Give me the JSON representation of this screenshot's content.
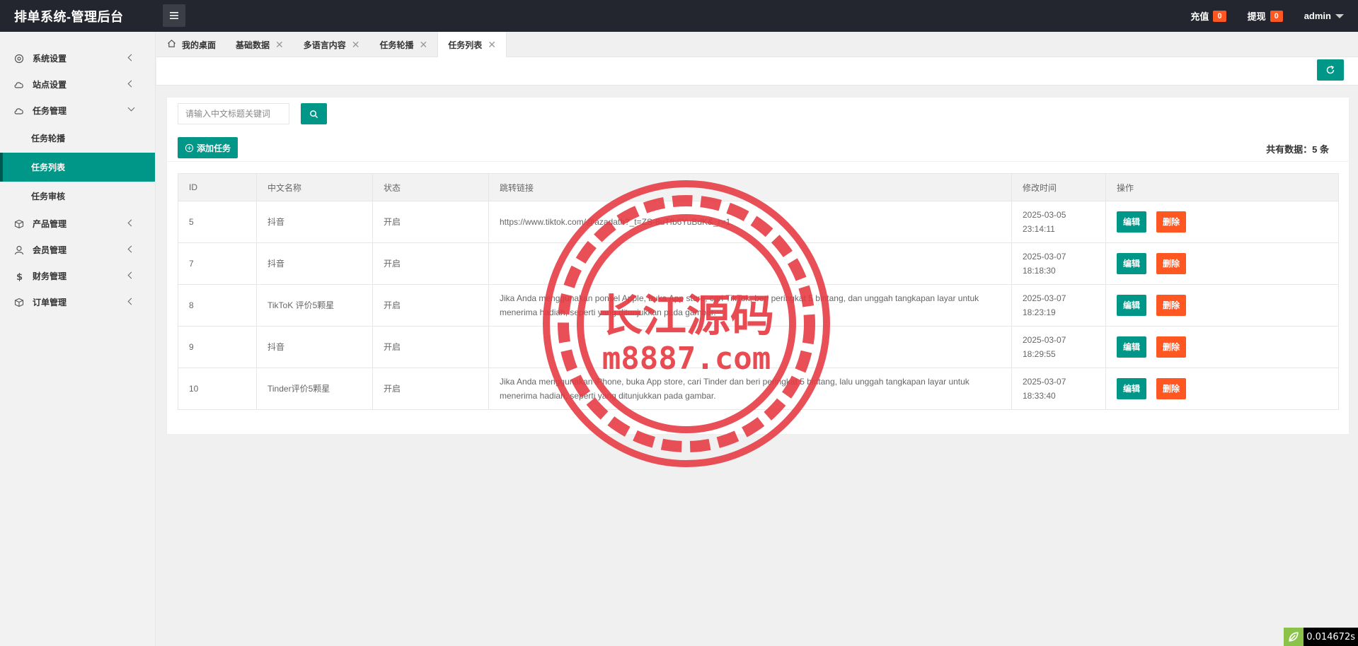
{
  "header": {
    "brand": "排单系统-管理后台",
    "recharge_label": "充值",
    "recharge_count": "0",
    "withdraw_label": "提现",
    "withdraw_count": "0",
    "user": "admin"
  },
  "sidebar": {
    "items": [
      {
        "label": "系统设置",
        "icon": "gear-icon"
      },
      {
        "label": "站点设置",
        "icon": "cloud-icon"
      },
      {
        "label": "任务管理",
        "icon": "cloud-icon"
      },
      {
        "label": "产品管理",
        "icon": "box-icon"
      },
      {
        "label": "会员管理",
        "icon": "user-icon"
      },
      {
        "label": "财务管理",
        "icon": "dollar-icon"
      },
      {
        "label": "订单管理",
        "icon": "box-icon"
      }
    ],
    "sub_items": [
      {
        "label": "任务轮播"
      },
      {
        "label": "任务列表"
      },
      {
        "label": "任务审核"
      }
    ]
  },
  "tabs": [
    {
      "label": "我的桌面"
    },
    {
      "label": "基础数据"
    },
    {
      "label": "多语言内容"
    },
    {
      "label": "任务轮播"
    },
    {
      "label": "任务列表"
    }
  ],
  "search": {
    "placeholder": "请输入中文标题关键词",
    "value": ""
  },
  "actions": {
    "add_label": "添加任务",
    "total_label": "共有数据：5 条"
  },
  "table": {
    "headers": [
      "ID",
      "中文名称",
      "状态",
      "跳转链接",
      "修改时间",
      "操作"
    ],
    "rows": [
      {
        "id": "5",
        "name": "抖音",
        "status": "开启",
        "link": "https://www.tiktok.com/@azadath?_t=ZS-8uTfb6YuBdK&_r=1",
        "time": "2025-03-05 23:14:11"
      },
      {
        "id": "7",
        "name": "抖音",
        "status": "开启",
        "link": "",
        "time": "2025-03-07 18:18:30"
      },
      {
        "id": "8",
        "name": "TikToK 评价5颗星",
        "status": "开启",
        "link": "Jika Anda menggunakan ponsel Apple, buka App store, cari TikTok, beri peringkat 5 bintang, dan unggah tangkapan layar untuk menerima hadiah, seperti yang ditunjukkan pada gambar.",
        "time": "2025-03-07 18:23:19"
      },
      {
        "id": "9",
        "name": "抖音",
        "status": "开启",
        "link": "",
        "time": "2025-03-07 18:29:55"
      },
      {
        "id": "10",
        "name": "Tinder评价5颗星",
        "status": "开启",
        "link": "Jika Anda menggunakan iPhone, buka App store, cari Tinder dan beri peringkat 5 bintang, lalu unggah tangkapan layar untuk menerima hadiah, seperti yang ditunjukkan pada gambar.",
        "time": "2025-03-07 18:33:40"
      }
    ],
    "edit_label": "编辑",
    "delete_label": "删除"
  },
  "watermark": {
    "title": "长江源码",
    "domain": "m8887.com"
  },
  "footer": {
    "timer": "0.014672s"
  },
  "colors": {
    "primary": "#009688",
    "danger": "#ff5722",
    "header_bg": "#23262e",
    "stamp": "#e5373f"
  }
}
